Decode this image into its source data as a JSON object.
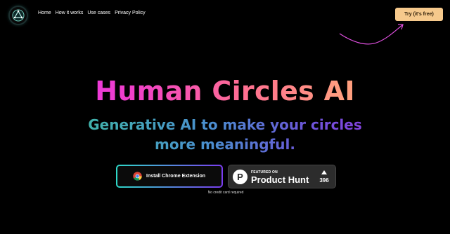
{
  "nav": {
    "links": [
      "Home",
      "How it works",
      "Use cases",
      "Privacy Policy"
    ],
    "cta_label": "Try (it's free)"
  },
  "hero": {
    "title": "Human Circles AI",
    "subtitle": "Generative AI to make your circles more meaningful."
  },
  "actions": {
    "chrome_label": "Install Chrome Extension",
    "product_hunt": {
      "featured": "FEATURED ON",
      "name": "Product Hunt",
      "logo_letter": "P",
      "count": "396"
    },
    "note": "No credit card required"
  },
  "colors": {
    "background": "#000000",
    "cta_bg": "#f6c98c",
    "title_gradient": [
      "#e62cff",
      "#ff9c80"
    ],
    "subtitle_gradient": [
      "#3fb8a6",
      "#8a3ce0"
    ],
    "arrow": "#e050e0"
  },
  "icons": [
    "logo-icon",
    "arrow-icon",
    "chrome-icon",
    "product-hunt-logo-icon",
    "upvote-icon"
  ]
}
